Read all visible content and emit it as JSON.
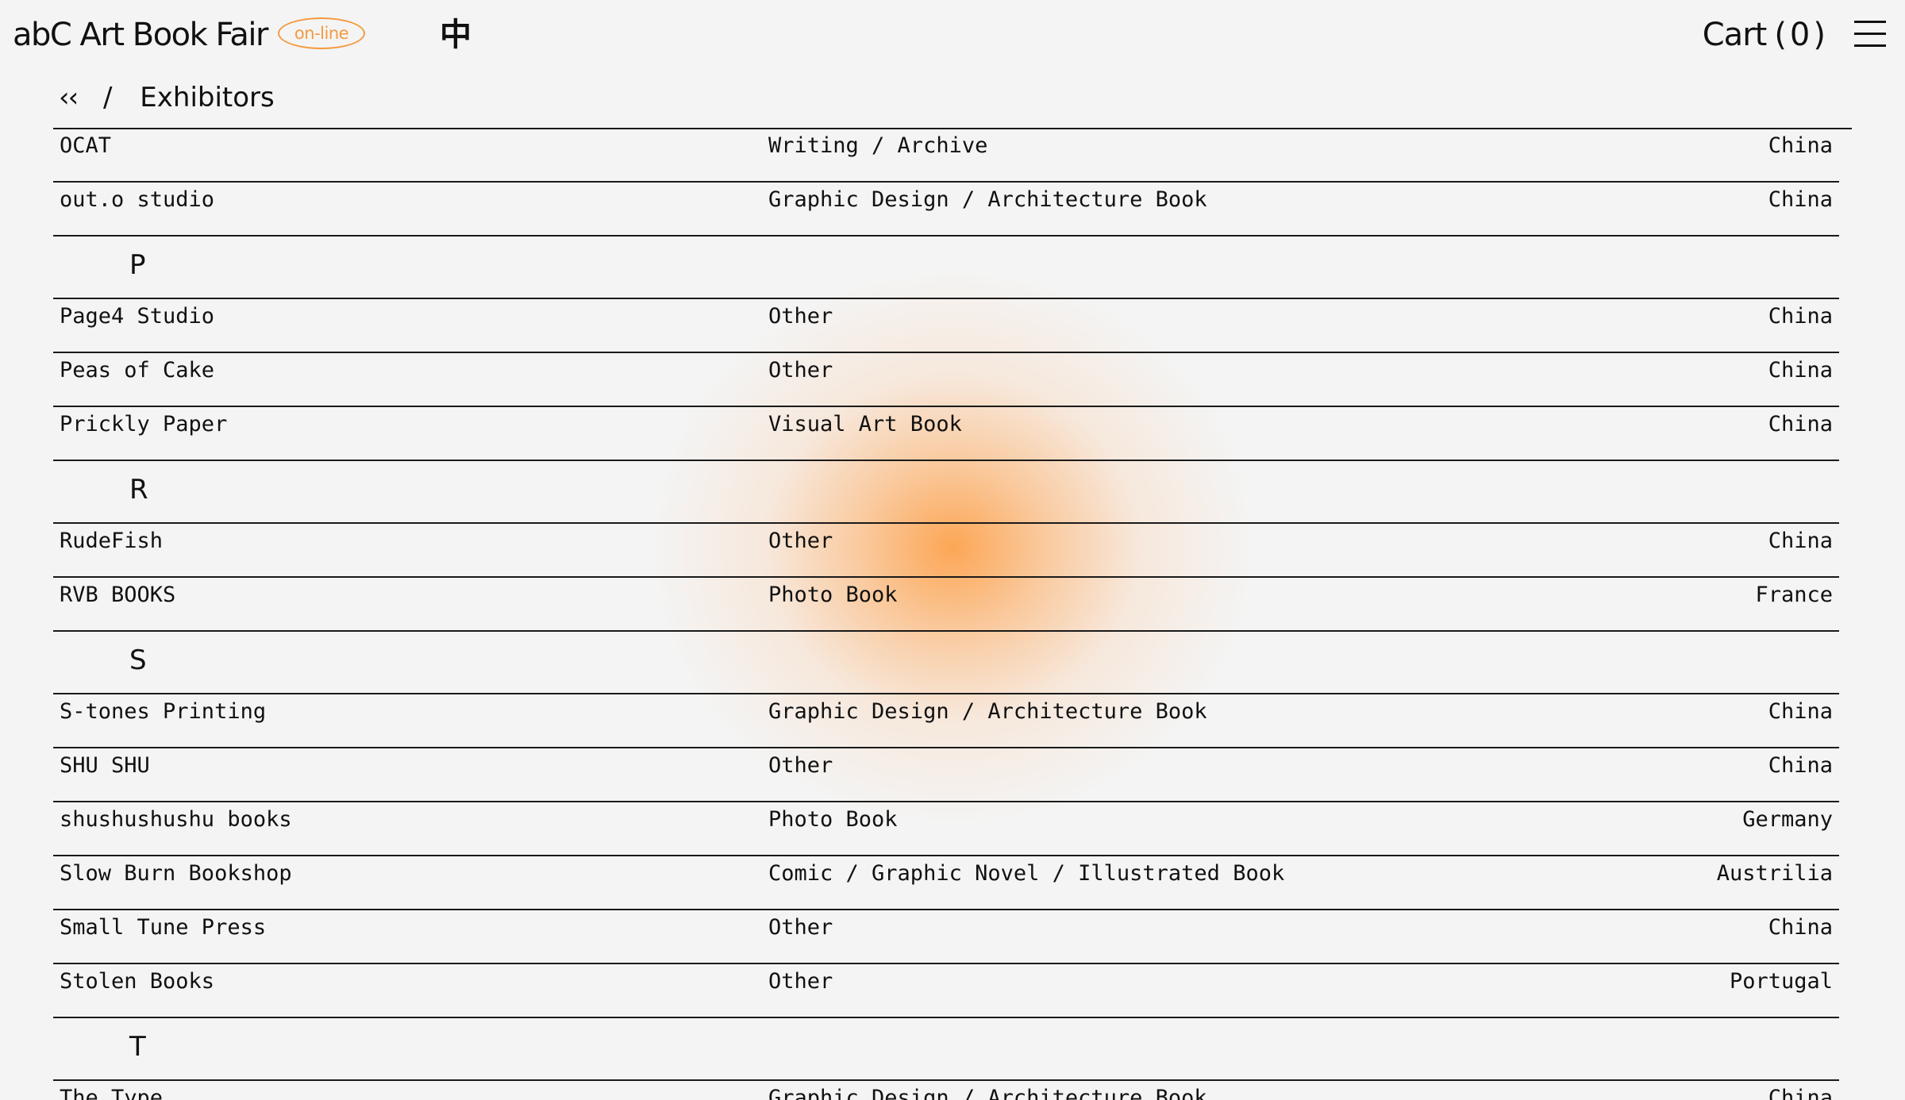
{
  "header": {
    "logo": "abC Art Book Fair",
    "badge": "on-line",
    "lang": "中",
    "cart_label": "Cart",
    "cart_count": "(0)"
  },
  "breadcrumb": {
    "back": "‹‹",
    "separator": "/",
    "current": "Exhibitors"
  },
  "sections": [
    {
      "letter": "",
      "rows": [
        {
          "name": "OCAT",
          "category": "Writing / Archive",
          "country": "China"
        },
        {
          "name": "out.o studio",
          "category": "Graphic Design / Architecture Book",
          "country": "China"
        }
      ]
    },
    {
      "letter": "P",
      "rows": [
        {
          "name": "Page4 Studio",
          "category": "Other",
          "country": "China"
        },
        {
          "name": "Peas of Cake",
          "category": "Other",
          "country": "China"
        },
        {
          "name": "Prickly Paper",
          "category": "Visual Art Book",
          "country": "China"
        }
      ]
    },
    {
      "letter": "R",
      "rows": [
        {
          "name": "RudeFish",
          "category": "Other",
          "country": "China"
        },
        {
          "name": "RVB BOOKS",
          "category": "Photo Book",
          "country": "France"
        }
      ]
    },
    {
      "letter": "S",
      "rows": [
        {
          "name": "S-tones Printing",
          "category": "Graphic Design / Architecture Book",
          "country": "China"
        },
        {
          "name": "SHU SHU",
          "category": "Other",
          "country": "China"
        },
        {
          "name": "shushushushu books",
          "category": "Photo Book",
          "country": "Germany"
        },
        {
          "name": "Slow Burn Bookshop",
          "category": "Comic / Graphic Novel / Illustrated Book",
          "country": "Austrilia"
        },
        {
          "name": "Small Tune Press",
          "category": "Other",
          "country": "China"
        },
        {
          "name": "Stolen Books",
          "category": "Other",
          "country": "Portugal"
        }
      ]
    },
    {
      "letter": "T",
      "rows": [
        {
          "name": "The Type",
          "category": "Graphic Design / Architecture Book",
          "country": "China"
        }
      ]
    }
  ],
  "colors": {
    "accent": "#f59a3e",
    "background": "#f4f4f4",
    "text": "#111111"
  }
}
